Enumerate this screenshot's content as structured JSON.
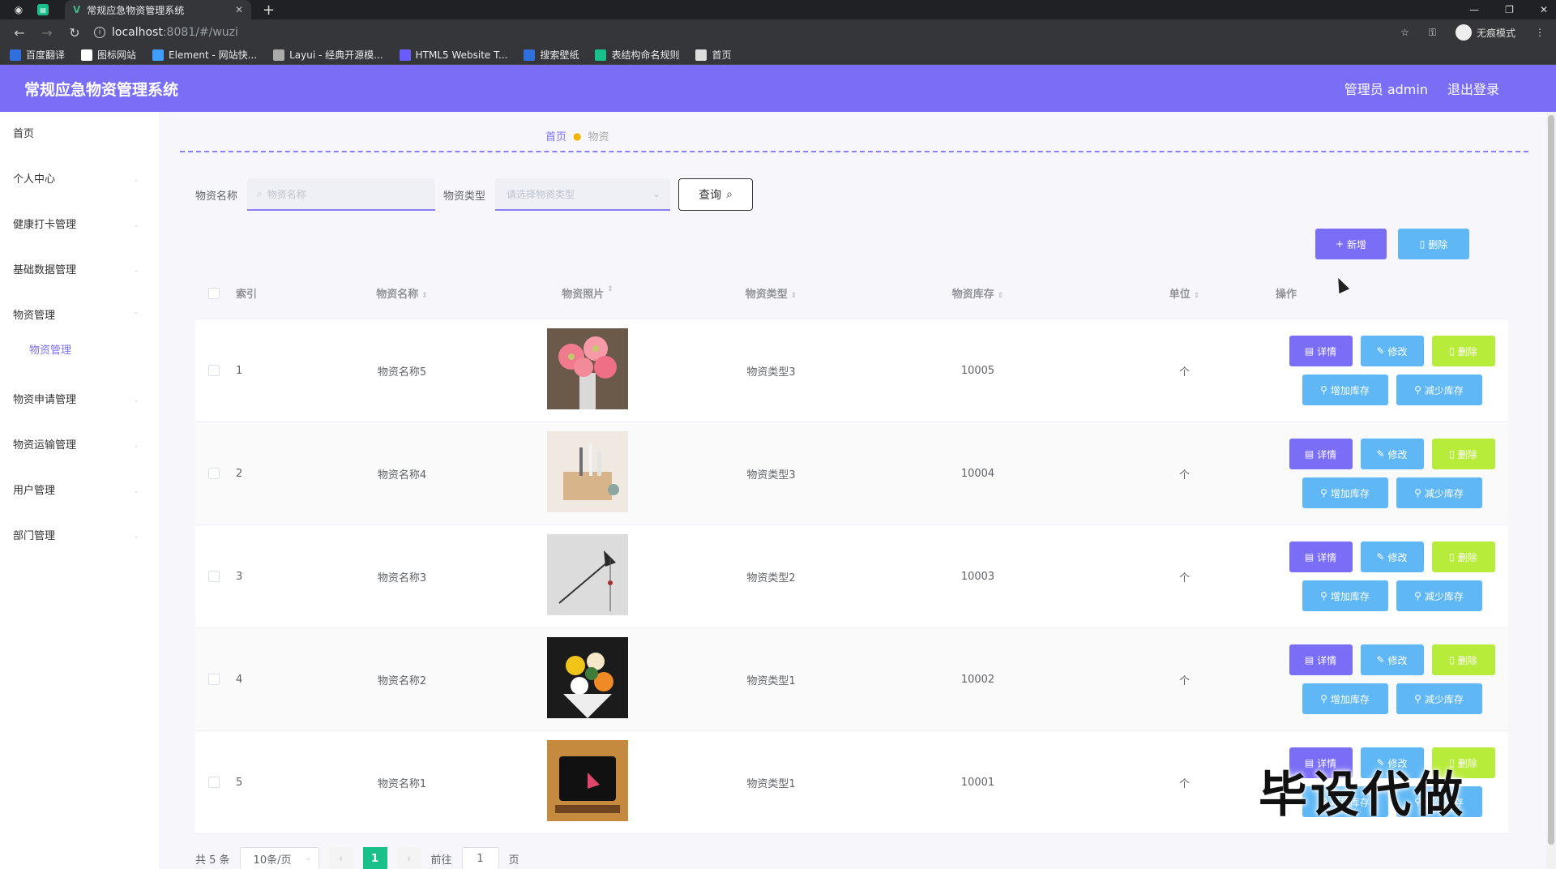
{
  "browser": {
    "tab_title": "常规应急物资管理系统",
    "new_tab_symbol": "+",
    "url_host": "localhost",
    "url_rest": ":8081/#/wuzi",
    "incognito_label": "无痕模式",
    "bookmarks": [
      {
        "label": "百度翻译",
        "color": "#2f6fde"
      },
      {
        "label": "图标网站",
        "color": "#ffffff"
      },
      {
        "label": "Element - 网站快...",
        "color": "#409eff"
      },
      {
        "label": "Layui - 经典开源模...",
        "color": "#aaaaaa"
      },
      {
        "label": "HTML5 Website T...",
        "color": "#6a5cff"
      },
      {
        "label": "搜索壁纸",
        "color": "#2f6fde"
      },
      {
        "label": "表结构命名规则",
        "color": "#19c08a"
      },
      {
        "label": "首页",
        "color": "#dddddd"
      }
    ]
  },
  "header": {
    "title": "常规应急物资管理系统",
    "user": "管理员 admin",
    "logout": "退出登录",
    "accent": "#7b6ef6"
  },
  "sidebar": {
    "items": [
      {
        "label": "首页"
      },
      {
        "label": "个人中心"
      },
      {
        "label": "健康打卡管理"
      },
      {
        "label": "基础数据管理"
      },
      {
        "label": "物资管理"
      },
      {
        "label": "物资申请管理"
      },
      {
        "label": "物资运输管理"
      },
      {
        "label": "用户管理"
      },
      {
        "label": "部门管理"
      }
    ],
    "active_sub": "物资管理"
  },
  "breadcrumb": {
    "home": "首页",
    "current": "物资"
  },
  "search": {
    "name_label": "物资名称",
    "name_placeholder": "物资名称",
    "type_label": "物资类型",
    "type_placeholder": "请选择物资类型",
    "query_button": "查询"
  },
  "toolbar": {
    "add": "新增",
    "delete": "删除"
  },
  "table": {
    "headers": [
      "索引",
      "物资名称",
      "物资照片",
      "物资类型",
      "物资库存",
      "单位",
      "操作"
    ],
    "unit_symbol": "个",
    "ops": {
      "detail": "详情",
      "edit": "修改",
      "delete": "删除",
      "increase": "增加库存",
      "decrease": "减少库存"
    },
    "rows": [
      {
        "index": "1",
        "name": "物资名称5",
        "type": "物资类型3",
        "stock": "10005",
        "unit": "个",
        "photo": "pink-gerbera-flowers"
      },
      {
        "index": "2",
        "name": "物资名称4",
        "type": "物资类型3",
        "stock": "10004",
        "unit": "个",
        "photo": "pen-holder-box"
      },
      {
        "index": "3",
        "name": "物资名称3",
        "type": "物资类型2",
        "stock": "10003",
        "unit": "个",
        "photo": "single-flower-stem"
      },
      {
        "index": "4",
        "name": "物资名称2",
        "type": "物资类型1",
        "stock": "10002",
        "unit": "个",
        "photo": "flower-bouquet"
      },
      {
        "index": "5",
        "name": "物资名称1",
        "type": "物资类型1",
        "stock": "10001",
        "unit": "个",
        "photo": "tablet-stand"
      }
    ]
  },
  "pagination": {
    "total": "共 5 条",
    "page_size": "10条/页",
    "current": "1",
    "goto_prefix": "前往",
    "goto_value": "1",
    "goto_suffix": "页"
  },
  "watermark": "毕设代做"
}
